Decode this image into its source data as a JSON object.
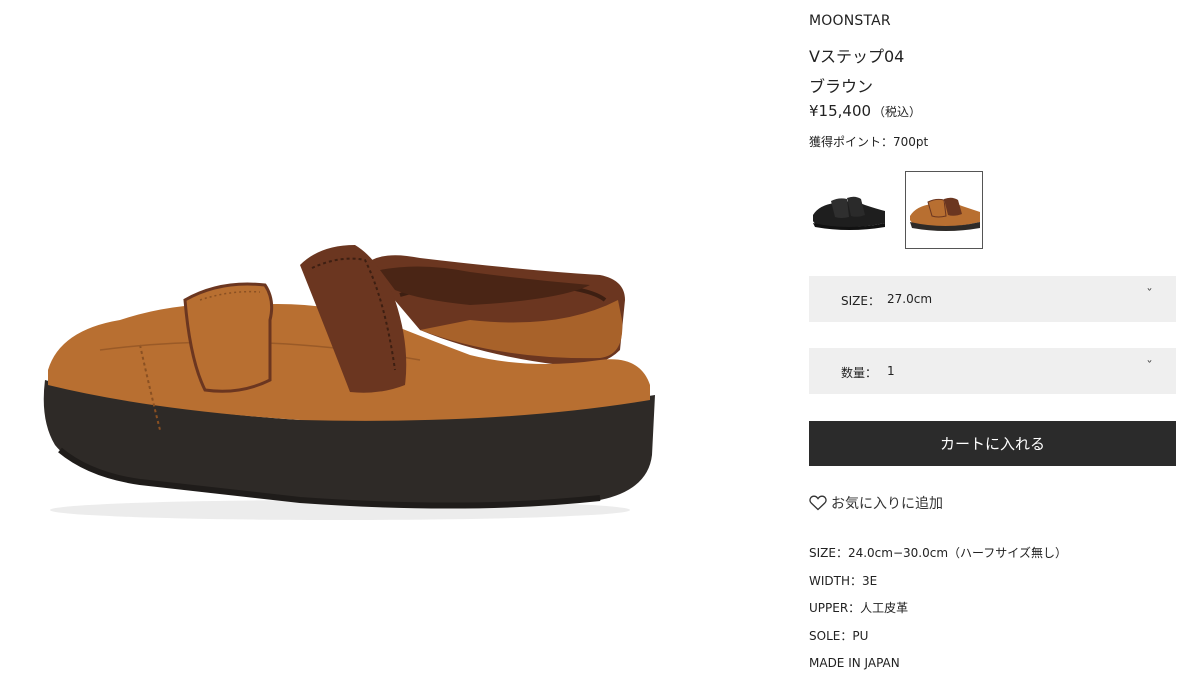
{
  "product": {
    "brand": "MOONSTAR",
    "name": "Vステップ04",
    "color": "ブラウン",
    "price": "¥15,400",
    "tax_note": "（税込）",
    "points_text": "獲得ポイント：700pt"
  },
  "thumbnails": [
    {
      "color_variant": "black",
      "selected": false
    },
    {
      "color_variant": "brown",
      "selected": true
    }
  ],
  "options": {
    "size_label": "SIZE：",
    "size_value": "27.0cm",
    "quantity_label": "数量：",
    "quantity_value": "1",
    "chevron": "˅"
  },
  "actions": {
    "add_to_cart": "カートに入れる",
    "favorite": "お気に入りに追加"
  },
  "specs": [
    "SIZE：24.0cm−30.0cm（ハーフサイズ無し）",
    "WIDTH：3E",
    "UPPER：人工皮革",
    "SOLE：PU",
    "MADE IN JAPAN"
  ],
  "colors": {
    "button_bg": "#2b2b2b",
    "select_bg": "#efefef",
    "suede": "#b86f31",
    "leather": "#6b3620",
    "sole": "#2e2a27"
  },
  "icons": {
    "favorite": "heart-outline-icon",
    "dropdown": "chevron-down-icon"
  }
}
